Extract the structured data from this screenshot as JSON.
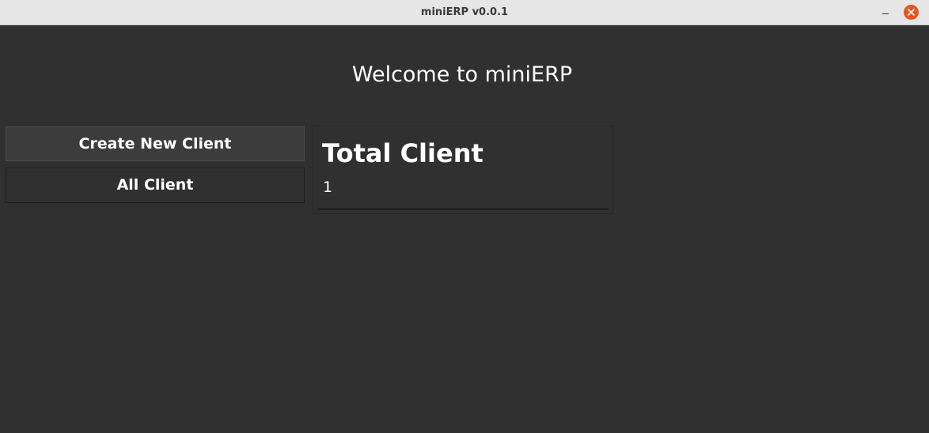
{
  "window": {
    "title": "miniERP v0.0.1",
    "minimize_symbol": "minimize-icon",
    "close_symbol": "close-icon",
    "close_color": "#e95420"
  },
  "main": {
    "welcome_text": "Welcome to miniERP"
  },
  "sidebar": {
    "buttons": [
      {
        "label": "Create New Client"
      },
      {
        "label": "All Client"
      }
    ]
  },
  "stats_card": {
    "title": "Total Client",
    "value": "1"
  },
  "colors": {
    "background": "#303030",
    "titlebar": "#e6e6e6",
    "text": "#ffffff"
  }
}
